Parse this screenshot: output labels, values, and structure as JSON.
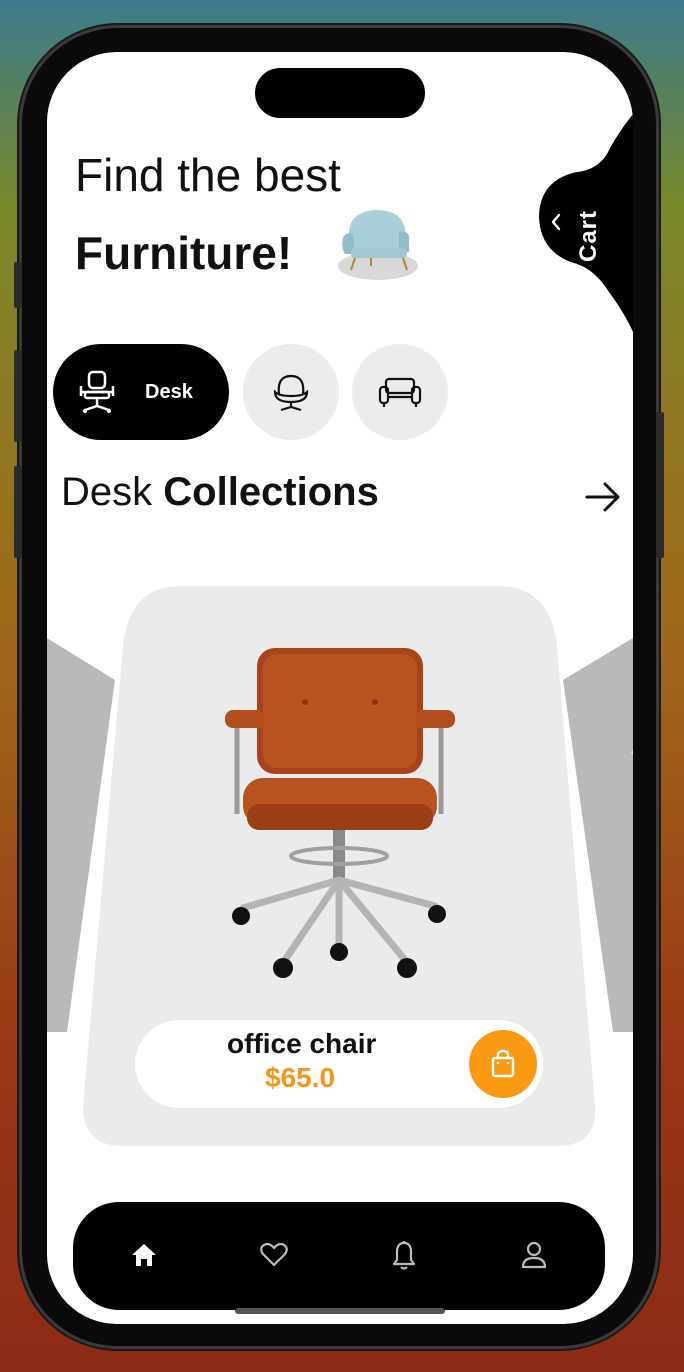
{
  "header": {
    "title_line1": "Find the best",
    "title_line2": "Furniture!"
  },
  "cart": {
    "label": "Cart"
  },
  "categories": [
    {
      "label": "Desk",
      "icon": "desk-chair-icon",
      "selected": true
    },
    {
      "label": "",
      "icon": "armchair-icon",
      "selected": false
    },
    {
      "label": "",
      "icon": "sofa-icon",
      "selected": false
    }
  ],
  "section": {
    "title_light": "Desk",
    "title_bold": "Collections"
  },
  "product": {
    "name": "office chair",
    "price": "$65.0"
  },
  "nav": [
    {
      "icon": "home-icon",
      "active": true
    },
    {
      "icon": "heart-icon",
      "active": false
    },
    {
      "icon": "bell-icon",
      "active": false
    },
    {
      "icon": "profile-icon",
      "active": false
    }
  ],
  "colors": {
    "accent": "#f99a12",
    "price": "#f5951a",
    "dark": "#000000",
    "card": "#ebebeb"
  }
}
